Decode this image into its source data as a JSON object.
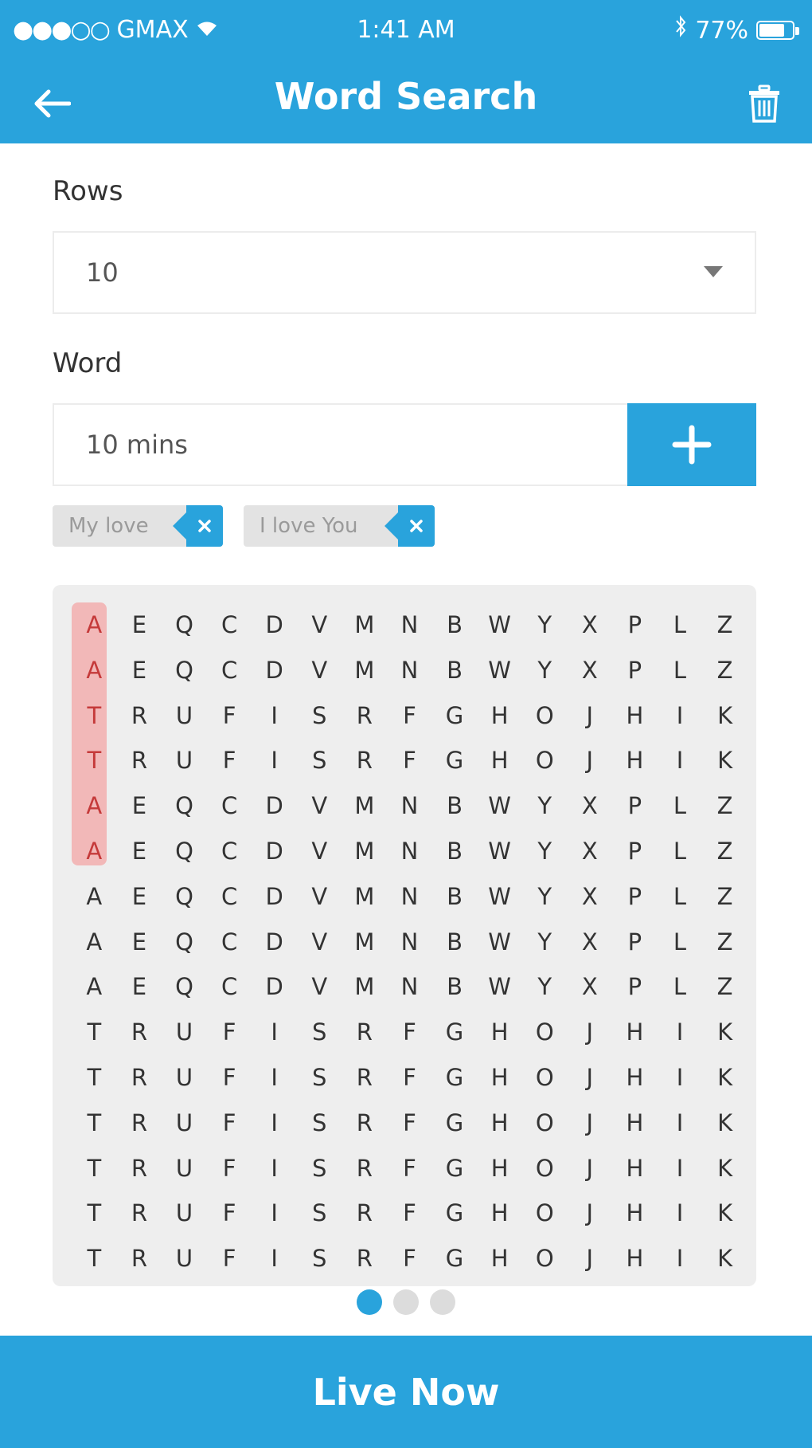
{
  "status_bar": {
    "signal": "●●●○○",
    "carrier": "GMAX",
    "time": "1:41 AM",
    "battery": "77%",
    "icons": [
      "wifi-icon",
      "bluetooth-icon",
      "battery-icon"
    ]
  },
  "header": {
    "title": "Word Search",
    "back_icon": "arrow-left-icon",
    "delete_icon": "trash-icon"
  },
  "form": {
    "rows_label": "Rows",
    "rows_value": "10",
    "word_label": "Word",
    "word_value": "10 mins"
  },
  "chips": [
    {
      "label": "My love"
    },
    {
      "label": "I love You"
    }
  ],
  "grid": {
    "highlight": {
      "column": 0,
      "from_row": 0,
      "to_row": 5
    },
    "rows": [
      [
        "A",
        "E",
        "Q",
        "C",
        "D",
        "V",
        "M",
        "N",
        "B",
        "W",
        "Y",
        "X",
        "P",
        "L",
        "Z"
      ],
      [
        "A",
        "E",
        "Q",
        "C",
        "D",
        "V",
        "M",
        "N",
        "B",
        "W",
        "Y",
        "X",
        "P",
        "L",
        "Z"
      ],
      [
        "T",
        "R",
        "U",
        "F",
        "I",
        "S",
        "R",
        "F",
        "G",
        "H",
        "O",
        "J",
        "H",
        "I",
        "K"
      ],
      [
        "T",
        "R",
        "U",
        "F",
        "I",
        "S",
        "R",
        "F",
        "G",
        "H",
        "O",
        "J",
        "H",
        "I",
        "K"
      ],
      [
        "A",
        "E",
        "Q",
        "C",
        "D",
        "V",
        "M",
        "N",
        "B",
        "W",
        "Y",
        "X",
        "P",
        "L",
        "Z"
      ],
      [
        "A",
        "E",
        "Q",
        "C",
        "D",
        "V",
        "M",
        "N",
        "B",
        "W",
        "Y",
        "X",
        "P",
        "L",
        "Z"
      ],
      [
        "A",
        "E",
        "Q",
        "C",
        "D",
        "V",
        "M",
        "N",
        "B",
        "W",
        "Y",
        "X",
        "P",
        "L",
        "Z"
      ],
      [
        "A",
        "E",
        "Q",
        "C",
        "D",
        "V",
        "M",
        "N",
        "B",
        "W",
        "Y",
        "X",
        "P",
        "L",
        "Z"
      ],
      [
        "A",
        "E",
        "Q",
        "C",
        "D",
        "V",
        "M",
        "N",
        "B",
        "W",
        "Y",
        "X",
        "P",
        "L",
        "Z"
      ],
      [
        "T",
        "R",
        "U",
        "F",
        "I",
        "S",
        "R",
        "F",
        "G",
        "H",
        "O",
        "J",
        "H",
        "I",
        "K"
      ],
      [
        "T",
        "R",
        "U",
        "F",
        "I",
        "S",
        "R",
        "F",
        "G",
        "H",
        "O",
        "J",
        "H",
        "I",
        "K"
      ],
      [
        "T",
        "R",
        "U",
        "F",
        "I",
        "S",
        "R",
        "F",
        "G",
        "H",
        "O",
        "J",
        "H",
        "I",
        "K"
      ],
      [
        "T",
        "R",
        "U",
        "F",
        "I",
        "S",
        "R",
        "F",
        "G",
        "H",
        "O",
        "J",
        "H",
        "I",
        "K"
      ],
      [
        "T",
        "R",
        "U",
        "F",
        "I",
        "S",
        "R",
        "F",
        "G",
        "H",
        "O",
        "J",
        "H",
        "I",
        "K"
      ],
      [
        "T",
        "R",
        "U",
        "F",
        "I",
        "S",
        "R",
        "F",
        "G",
        "H",
        "O",
        "J",
        "H",
        "I",
        "K"
      ]
    ]
  },
  "pager": {
    "count": 3,
    "active": 0
  },
  "bottom_button": {
    "label": "Live Now"
  },
  "colors": {
    "accent": "#29a3dc",
    "highlight": "#f2b8b8",
    "grid_bg": "#eeeeee",
    "chip_bg": "#e3e3e3"
  }
}
